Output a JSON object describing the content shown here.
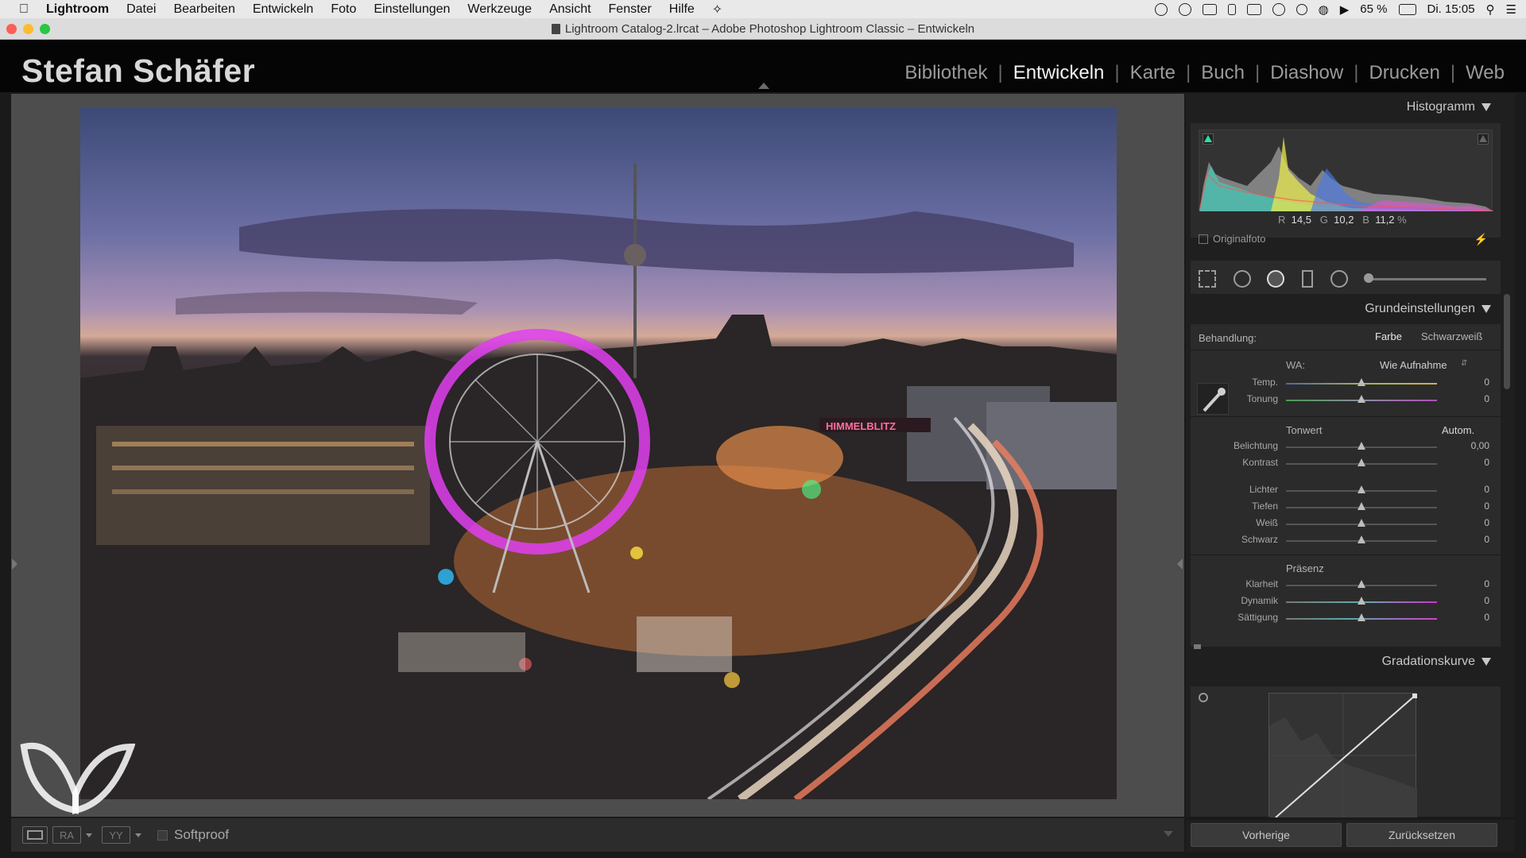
{
  "menubar": {
    "app": "Lightroom",
    "items": [
      "Datei",
      "Bearbeiten",
      "Entwickeln",
      "Foto",
      "Einstellungen",
      "Werkzeuge",
      "Ansicht",
      "Fenster",
      "Hilfe"
    ],
    "battery": "65 %",
    "clock": "Di. 15:05"
  },
  "window": {
    "title": "Lightroom Catalog-2.lrcat – Adobe Photoshop Lightroom Classic – Entwickeln"
  },
  "header": {
    "identity_plate": "Stefan Schäfer",
    "modules": [
      "Bibliothek",
      "Entwickeln",
      "Karte",
      "Buch",
      "Diashow",
      "Drucken",
      "Web"
    ],
    "active_module": "Entwickeln"
  },
  "photo": {
    "sign_text": "HIMMELBLITZ"
  },
  "toolbar": {
    "view_a": "RA",
    "view_b": "YY",
    "softproof_label": "Softproof"
  },
  "histogram": {
    "title": "Histogramm",
    "r_label": "R",
    "r_value": "14,5",
    "g_label": "G",
    "g_value": "10,2",
    "b_label": "B",
    "b_value": "11,2",
    "unit": "%",
    "original_label": "Originalfoto"
  },
  "basic": {
    "title": "Grundeinstellungen",
    "treatment_label": "Behandlung:",
    "treatment_color": "Farbe",
    "treatment_bw": "Schwarzweiß",
    "wb_label": "WA:",
    "wb_value": "Wie Aufnahme",
    "temp_label": "Temp.",
    "temp_value": "0",
    "tint_label": "Tonung",
    "tint_value": "0",
    "tone_label": "Tonwert",
    "auto_label": "Autom.",
    "exposure_label": "Belichtung",
    "exposure_value": "0,00",
    "contrast_label": "Kontrast",
    "contrast_value": "0",
    "highlights_label": "Lichter",
    "highlights_value": "0",
    "shadows_label": "Tiefen",
    "shadows_value": "0",
    "whites_label": "Weiß",
    "whites_value": "0",
    "blacks_label": "Schwarz",
    "blacks_value": "0",
    "presence_label": "Präsenz",
    "clarity_label": "Klarheit",
    "clarity_value": "0",
    "vibrance_label": "Dynamik",
    "vibrance_value": "0",
    "saturation_label": "Sättigung",
    "saturation_value": "0"
  },
  "curve": {
    "title": "Gradationskurve"
  },
  "bottom": {
    "previous": "Vorherige",
    "reset": "Zurücksetzen"
  },
  "colors": {
    "accent_active": "#f2f2f2",
    "panel_bg": "#2b2b2b",
    "background": "#4d4d4d"
  }
}
